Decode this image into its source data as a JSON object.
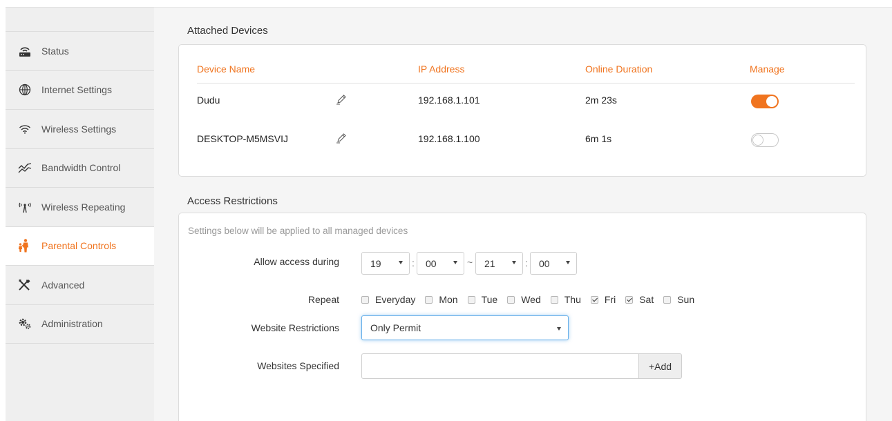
{
  "sidebar": {
    "items": [
      {
        "label": "Status",
        "icon": "router-icon",
        "active": false
      },
      {
        "label": "Internet Settings",
        "icon": "globe-icon",
        "active": false
      },
      {
        "label": "Wireless Settings",
        "icon": "wifi-icon",
        "active": false
      },
      {
        "label": "Bandwidth Control",
        "icon": "bandwidth-icon",
        "active": false
      },
      {
        "label": "Wireless Repeating",
        "icon": "antenna-icon",
        "active": false
      },
      {
        "label": "Parental Controls",
        "icon": "parent-child-icon",
        "active": true
      },
      {
        "label": "Advanced",
        "icon": "tools-icon",
        "active": false
      },
      {
        "label": "Administration",
        "icon": "gears-icon",
        "active": false
      }
    ]
  },
  "attached": {
    "title": "Attached Devices",
    "headers": {
      "device_name": "Device Name",
      "ip": "IP Address",
      "duration": "Online Duration",
      "manage": "Manage"
    },
    "rows": [
      {
        "name": "Dudu",
        "ip": "192.168.1.101",
        "duration": "2m 23s",
        "managed": true
      },
      {
        "name": "DESKTOP-M5MSVIJ",
        "ip": "192.168.1.100",
        "duration": "6m 1s",
        "managed": false
      }
    ]
  },
  "access": {
    "title": "Access Restrictions",
    "hint": "Settings below will be applied to all managed devices",
    "allow_label": "Allow access during",
    "start_hour": "19",
    "start_min": "00",
    "range_sep": "~",
    "time_sep": ":",
    "end_hour": "21",
    "end_min": "00",
    "repeat_label": "Repeat",
    "days": [
      {
        "label": "Everyday",
        "checked": false
      },
      {
        "label": "Mon",
        "checked": false
      },
      {
        "label": "Tue",
        "checked": false
      },
      {
        "label": "Wed",
        "checked": false
      },
      {
        "label": "Thu",
        "checked": false
      },
      {
        "label": "Fri",
        "checked": true
      },
      {
        "label": "Sat",
        "checked": true
      },
      {
        "label": "Sun",
        "checked": false
      }
    ],
    "website_restrictions_label": "Website Restrictions",
    "website_restrictions_value": "Only Permit",
    "websites_specified_label": "Websites Specified",
    "websites_specified_value": "",
    "add_label": "+Add"
  },
  "colors": {
    "accent": "#f0741f",
    "sidebar_bg": "#efefef",
    "main_bg": "#f5f5f5"
  }
}
